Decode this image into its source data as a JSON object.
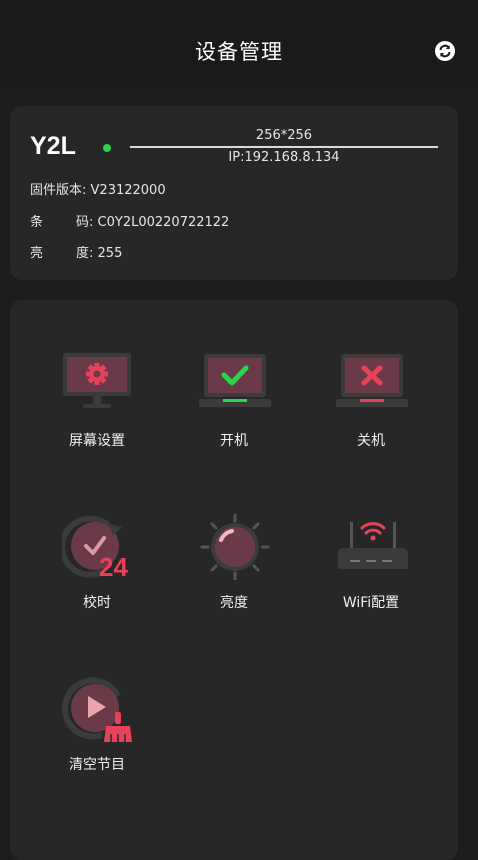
{
  "header": {
    "title": "设备管理",
    "refresh_icon": "refresh-icon"
  },
  "device": {
    "model": "Y2L",
    "status_color": "#2ed34c",
    "resolution": "256*256",
    "ip": "IP:192.168.8.134",
    "firmware_label": "固件版本:",
    "firmware_value": "V23122000",
    "barcode_label_1": "条",
    "barcode_label_2": "码:",
    "barcode_value": "C0Y2L00220722122",
    "brightness_label_1": "亮",
    "brightness_label_2": "度:",
    "brightness_value": "255"
  },
  "functions": [
    {
      "label": "屏幕设置",
      "icon": "monitor-settings-icon"
    },
    {
      "label": "开机",
      "icon": "power-on-icon"
    },
    {
      "label": "关机",
      "icon": "power-off-icon"
    },
    {
      "label": "校时",
      "icon": "time-sync-icon"
    },
    {
      "label": "亮度",
      "icon": "brightness-icon"
    },
    {
      "label": "WiFi配置",
      "icon": "wifi-router-icon"
    },
    {
      "label": "清空节目",
      "icon": "clear-program-icon"
    }
  ],
  "colors": {
    "accent": "#e8425a",
    "ok": "#2ed34c"
  }
}
